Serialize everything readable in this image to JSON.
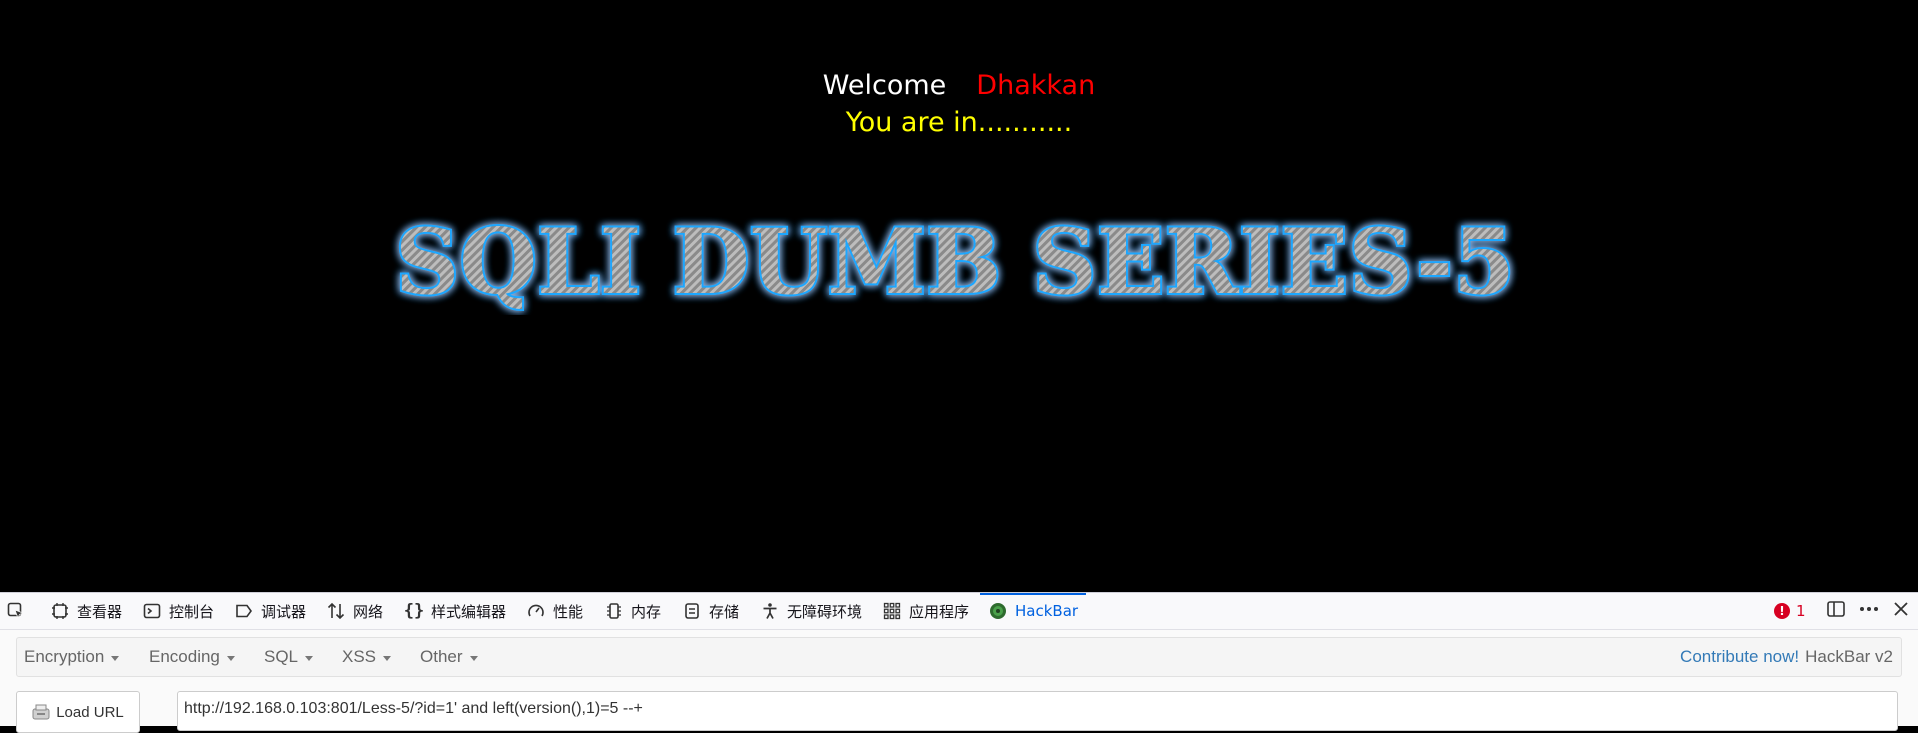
{
  "page": {
    "welcome_label": "Welcome",
    "user_name": "Dhakkan",
    "status_text": "You are in...........",
    "banner_text": "SQLI DUMB SERIES-5"
  },
  "devtools": {
    "tabs": [
      {
        "label": "查看器",
        "icon": "inspector-icon"
      },
      {
        "label": "控制台",
        "icon": "console-icon"
      },
      {
        "label": "调试器",
        "icon": "debugger-icon"
      },
      {
        "label": "网络",
        "icon": "network-icon"
      },
      {
        "label": "样式编辑器",
        "icon": "style-editor-icon"
      },
      {
        "label": "性能",
        "icon": "performance-icon"
      },
      {
        "label": "内存",
        "icon": "memory-icon"
      },
      {
        "label": "存储",
        "icon": "storage-icon"
      },
      {
        "label": "无障碍环境",
        "icon": "accessibility-icon"
      },
      {
        "label": "应用程序",
        "icon": "application-icon"
      },
      {
        "label": "HackBar",
        "icon": "hackbar-icon"
      }
    ],
    "active_tab": "HackBar",
    "error_count": "1"
  },
  "hackbar": {
    "menu": [
      "Encryption",
      "Encoding",
      "SQL",
      "XSS",
      "Other"
    ],
    "contribute_label": "Contribute now!",
    "version_label": "HackBar v2",
    "load_url_label": "Load URL",
    "url_value": "http://192.168.0.103:801/Less-5/?id=1' and left(version(),1)=5 --+"
  },
  "colors": {
    "welcome": "#ffffff",
    "user_name": "#ff0000",
    "status": "#ffff00",
    "banner_glow": "#1ea7ff",
    "active_tab": "#0061e0",
    "error": "#d70022",
    "link": "#337ab7"
  }
}
